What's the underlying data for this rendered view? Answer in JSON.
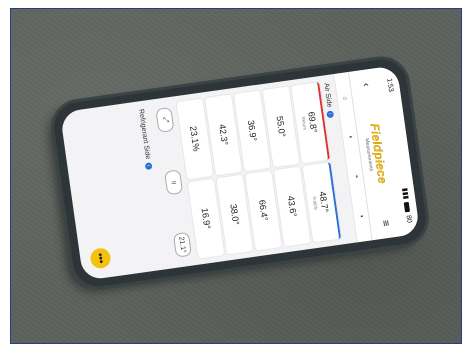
{
  "app": {
    "brand": "Fieldpiece",
    "brand_sub": "Measurements",
    "status_time": "1:53",
    "status_battery": "80"
  },
  "air_side": {
    "title": "Air Side",
    "readings": [
      {
        "value": "69.8°",
        "label": "Return",
        "accent": "red"
      },
      {
        "value": "48.7°",
        "label": "Supply",
        "accent": "blue"
      },
      {
        "value": "55.0°",
        "label": "",
        "accent": "none"
      },
      {
        "value": "43.6°",
        "label": "",
        "accent": "none"
      },
      {
        "value": "36.9°",
        "label": "",
        "accent": "none"
      },
      {
        "value": "66.4°",
        "label": "",
        "accent": "none"
      },
      {
        "value": "42.3°",
        "label": "",
        "accent": "none"
      },
      {
        "value": "38.0°",
        "label": "",
        "accent": "none"
      },
      {
        "value": "23.1%",
        "label": "",
        "accent": "none"
      },
      {
        "value": "16.9°",
        "label": "",
        "accent": "none"
      }
    ]
  },
  "extra_reading": {
    "value": "21.1°"
  },
  "refrigerant_side": {
    "title": "Refrigerant Side"
  },
  "colors": {
    "accent": "#f2b705",
    "return": "#d9352e",
    "supply": "#2d6fd8"
  },
  "fab_label": "•••"
}
